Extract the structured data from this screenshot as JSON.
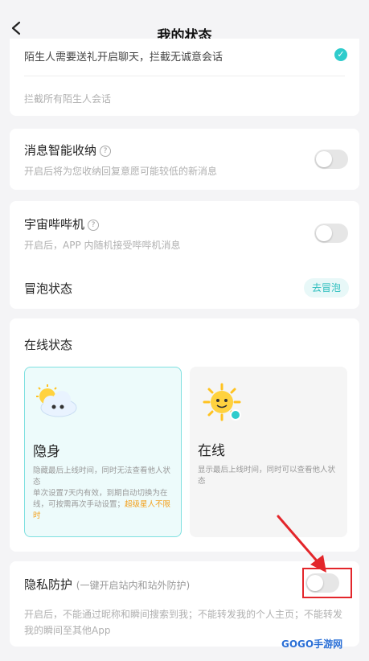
{
  "header": {
    "title": "我的状态"
  },
  "stranger": {
    "option_text": "陌生人需要送礼开启聊天，拦截无诚意会话",
    "block_all_text": "拦截所有陌生人会话"
  },
  "smart_inbox": {
    "title": "消息智能收纳",
    "subtitle": "开启后将为您收纳回复意愿可能较低的新消息"
  },
  "cosmic_beep": {
    "title": "宇宙哔哔机",
    "subtitle": "开启后，APP 内随机接受哔哔机消息"
  },
  "bubble": {
    "title": "冒泡状态",
    "button_label": "去冒泡"
  },
  "online_status": {
    "title": "在线状态",
    "options": [
      {
        "label": "隐身",
        "desc_1": "隐藏最后上线时间，同时无法查看他人状态",
        "desc_2": "单次设置7天内有效，到期自动切换为在线，可按需再次手动设置；",
        "desc_highlight": "超级星人不限时"
      },
      {
        "label": "在线",
        "desc_1": "显示最后上线时间，同时可以查看他人状态"
      }
    ]
  },
  "privacy": {
    "title": "隐私防护",
    "note": "(一键开启站内和站外防护)",
    "desc": "开启后，不能通过昵称和瞬间搜索到我；不能转发我的个人主页；不能转发我的瞬间至其他App"
  },
  "watermark": "GOGO手游网",
  "colors": {
    "accent": "#2fcccc",
    "highlight": "#f3a11d",
    "annotation": "#e3262b"
  }
}
